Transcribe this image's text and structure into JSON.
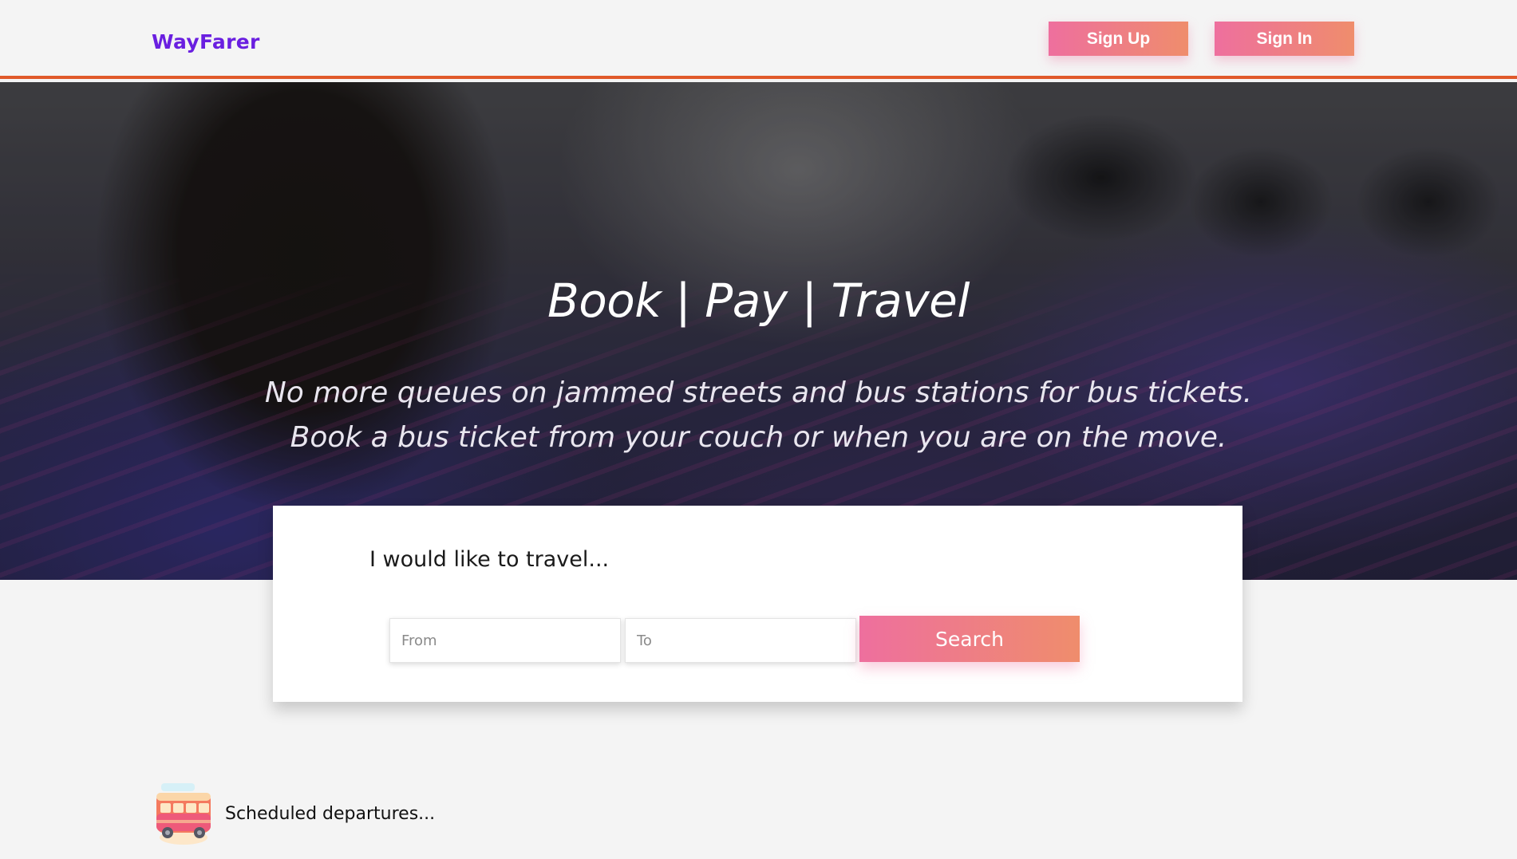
{
  "navbar": {
    "brand": "WayFarer",
    "signup_label": "Sign Up",
    "signin_label": "Sign In"
  },
  "hero": {
    "title": "Book | Pay | Travel",
    "subtitle_line1": "No more queues on jammed streets and bus stations for bus tickets.",
    "subtitle_line2": "Book a bus ticket from your couch or when you are on the move."
  },
  "search": {
    "heading": "I would like to travel...",
    "from_placeholder": "From",
    "to_placeholder": "To",
    "from_value": "",
    "to_value": "",
    "button_label": "Search"
  },
  "departures": {
    "label": "Scheduled departures...",
    "icon": "bus-icon"
  },
  "colors": {
    "brand": "#6a1fe0",
    "accent_start": "#ee6f9e",
    "accent_end": "#ef8d6c",
    "nav_border": "#e0592a",
    "page_bg": "#f4f4f4"
  }
}
